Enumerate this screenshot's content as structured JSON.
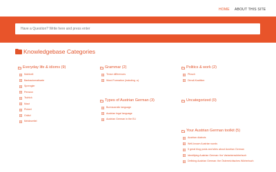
{
  "nav": {
    "home": "HOME",
    "about": "ABOUT THIS SITE"
  },
  "search": {
    "placeholder": "Have a Question? Write here and press enter"
  },
  "main": {
    "heading": "Knowledgebase Categories"
  },
  "categories": {
    "everyday": {
      "title": "Everyday life & idioms (9)",
      "posts": [
        "Mahlzeit",
        "Bankautomatkarte",
        "Sprengler",
        "Pension",
        "Tschick",
        "Maut",
        "Pickerl",
        "Grätzl",
        "Meldezettel"
      ]
    },
    "grammar": {
      "title": "Grammar (2)",
      "posts": [
        "Tense differences",
        "Word Formation (including -s)"
      ]
    },
    "politics": {
      "title": "Politics & work (2)",
      "posts": [
        "Pfusch",
        "Dirndl-Koalition"
      ]
    },
    "types": {
      "title": "Types of Austrian German (3)",
      "posts": [
        "Bureaucratic language",
        "Austrian legal language",
        "Austrian German in the EU"
      ]
    },
    "uncategorized": {
      "title": "Uncategorized (0)"
    },
    "toolkit": {
      "title": "Your Austrian German toolkit (5)",
      "posts": [
        "Austrian dialects",
        "Well-known Austrian words",
        "5 great blog posts and sites about Austrian German",
        "Identifying Austrian German: the Variantenwörterbuch",
        "Defining Austrian German: the Österreichisches Wörterbuch"
      ]
    }
  },
  "colors": {
    "accent": "#e8542a",
    "text": "#333333",
    "background": "#ffffff"
  },
  "icons": {
    "heading": "folder-icon",
    "category": "folder-icon",
    "post": "document-icon"
  }
}
